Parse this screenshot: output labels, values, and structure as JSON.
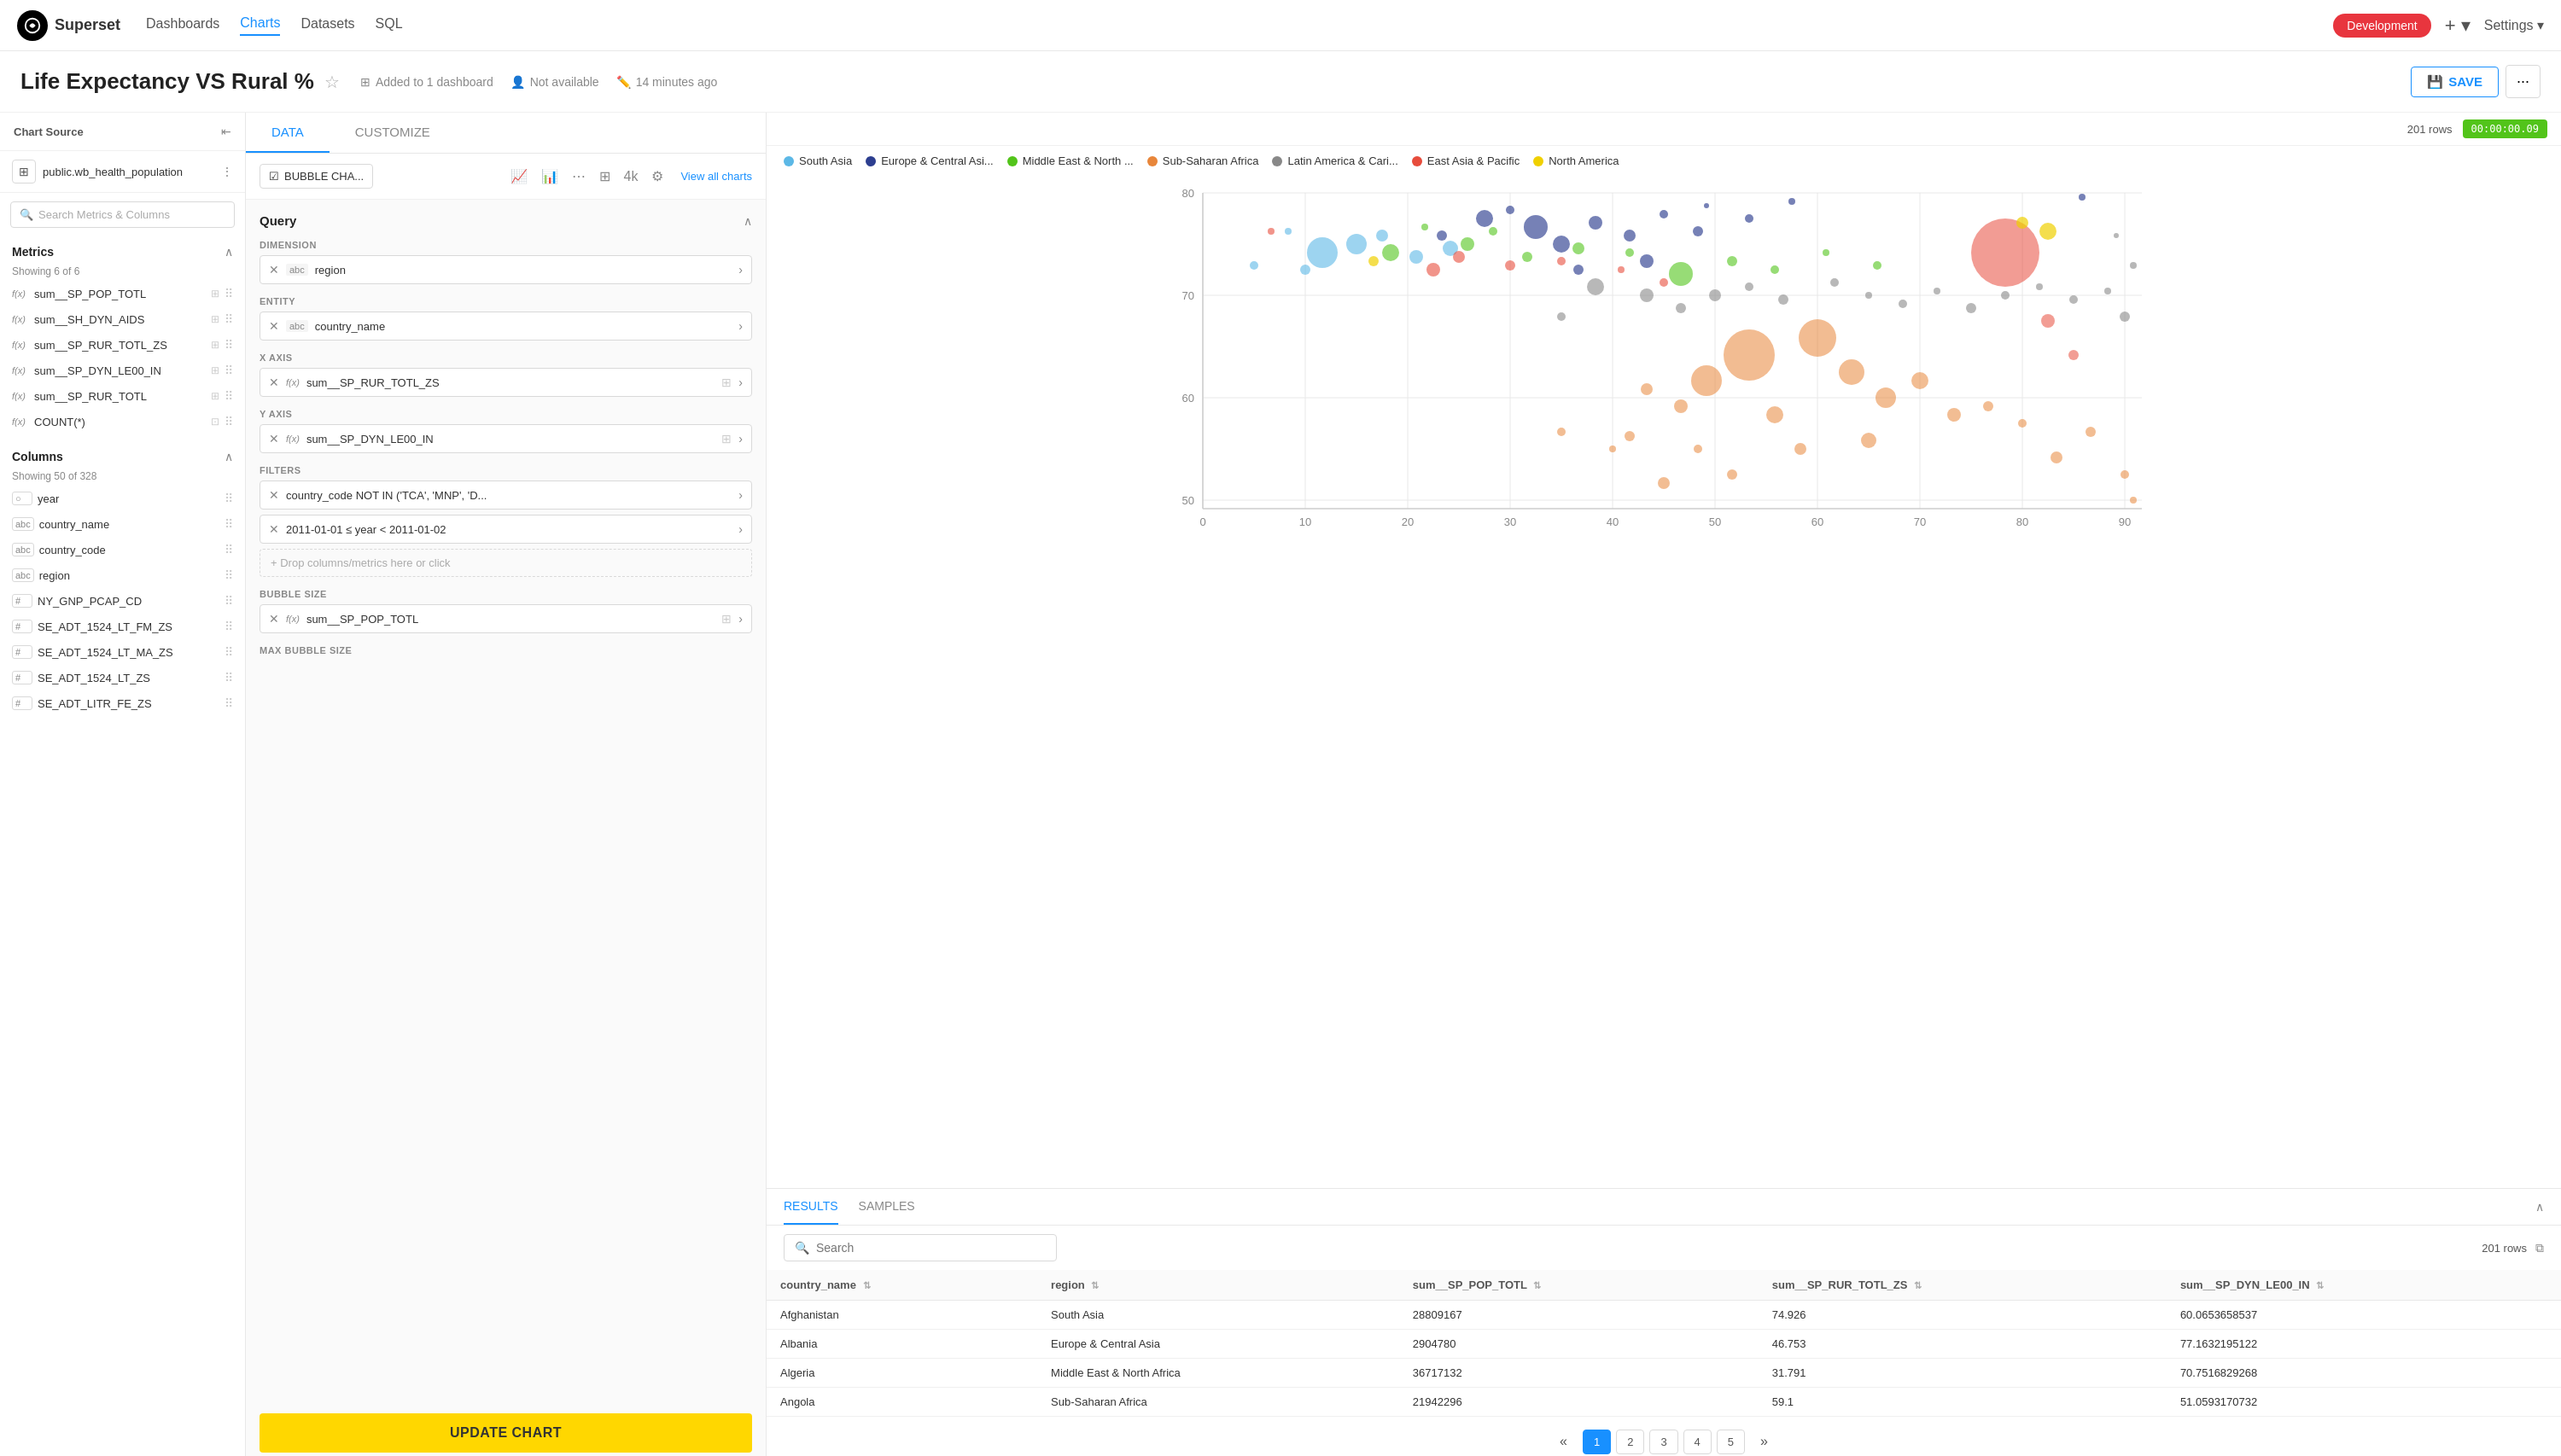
{
  "app": {
    "logo": "Superset",
    "environment": "Development"
  },
  "nav": {
    "links": [
      {
        "label": "Dashboards",
        "active": false
      },
      {
        "label": "Charts",
        "active": true
      },
      {
        "label": "Datasets",
        "active": false
      },
      {
        "label": "SQL",
        "active": false
      }
    ],
    "settings_label": "Settings ▾",
    "plus_label": "+ ▾"
  },
  "page": {
    "title": "Life Expectancy VS Rural %",
    "meta": [
      {
        "icon": "dashboard-icon",
        "text": "Added to 1 dashboard"
      },
      {
        "icon": "user-icon",
        "text": "Not available"
      },
      {
        "icon": "edit-icon",
        "text": "14 minutes ago"
      }
    ],
    "save_label": "SAVE"
  },
  "sidebar": {
    "chart_source_label": "Chart Source",
    "datasource": "public.wb_health_population",
    "search_placeholder": "Search Metrics & Columns",
    "metrics_label": "Metrics",
    "metrics_count": "Showing 6 of 6",
    "metrics": [
      {
        "name": "sum__SP_POP_TOTL",
        "type": "f(x)"
      },
      {
        "name": "sum__SH_DYN_AIDS",
        "type": "f(x)"
      },
      {
        "name": "sum__SP_RUR_TOTL_ZS",
        "type": "f(x)"
      },
      {
        "name": "sum__SP_DYN_LE00_IN",
        "type": "f(x)"
      },
      {
        "name": "sum__SP_RUR_TOTL",
        "type": "f(x)"
      },
      {
        "name": "COUNT(*)",
        "type": "f(x)"
      }
    ],
    "columns_label": "Columns",
    "columns_count": "Showing 50 of 328",
    "columns": [
      {
        "name": "year",
        "type": "○"
      },
      {
        "name": "country_name",
        "type": "abc"
      },
      {
        "name": "country_code",
        "type": "abc"
      },
      {
        "name": "region",
        "type": "abc"
      },
      {
        "name": "NY_GNP_PCAP_CD",
        "type": "#"
      },
      {
        "name": "SE_ADT_1524_LT_FM_ZS",
        "type": "#"
      },
      {
        "name": "SE_ADT_1524_LT_MA_ZS",
        "type": "#"
      },
      {
        "name": "SE_ADT_1524_LT_ZS",
        "type": "#"
      },
      {
        "name": "SE_ADT_LITR_FE_ZS",
        "type": "#"
      }
    ]
  },
  "center_panel": {
    "tabs": [
      "DATA",
      "CUSTOMIZE"
    ],
    "active_tab": "DATA",
    "chart_type": "BUBBLE CHA...",
    "toolbar_icons": [
      "line-chart",
      "bar-chart",
      "scatter-chart",
      "table",
      "4k",
      "settings"
    ],
    "view_all_label": "View all charts",
    "query_title": "Query",
    "dimension_label": "DIMENSION",
    "dimension_value": "region",
    "entity_label": "ENTITY",
    "entity_value": "country_name",
    "xaxis_label": "X AXIS",
    "xaxis_value": "sum__SP_RUR_TOTL_ZS",
    "yaxis_label": "Y AXIS",
    "yaxis_value": "sum__SP_DYN_LE00_IN",
    "filters_label": "FILTERS",
    "filter1": "country_code NOT IN ('TCA', 'MNP', 'D...",
    "filter2": "2011-01-01 ≤ year < 2011-01-02",
    "drop_zone": "+ Drop columns/metrics here or click",
    "bubble_size_label": "BUBBLE SIZE",
    "bubble_size_value": "sum__SP_POP_TOTL",
    "max_bubble_size_label": "MAX BUBBLE SIZE",
    "update_chart_label": "UPDATE CHART"
  },
  "chart": {
    "rows_count": "201 rows",
    "time_badge": "00:00:00.09",
    "legend": [
      {
        "label": "South Asia",
        "color": "#5cb8e6"
      },
      {
        "label": "Europe & Central Asi...",
        "color": "#2c3e8f"
      },
      {
        "label": "Middle East & North ...",
        "color": "#52c41a"
      },
      {
        "label": "Sub-Saharan Africa",
        "color": "#e8863a"
      },
      {
        "label": "Latin America & Cari...",
        "color": "#666"
      },
      {
        "label": "East Asia & Pacific",
        "color": "#e74c3c"
      },
      {
        "label": "North America",
        "color": "#f0d000"
      }
    ],
    "x_axis_ticks": [
      "0",
      "10",
      "20",
      "30",
      "40",
      "50",
      "60",
      "70",
      "80",
      "90"
    ],
    "y_axis_ticks": [
      "80",
      "70",
      "60",
      "50"
    ]
  },
  "results": {
    "tabs": [
      "RESULTS",
      "SAMPLES"
    ],
    "active_tab": "RESULTS",
    "search_placeholder": "Search",
    "rows_count": "201 rows",
    "columns": [
      {
        "label": "country_name",
        "sortable": true
      },
      {
        "label": "region",
        "sortable": true
      },
      {
        "label": "sum__SP_POP_TOTL",
        "sortable": true
      },
      {
        "label": "sum__SP_RUR_TOTL_ZS",
        "sortable": true
      },
      {
        "label": "sum__SP_DYN_LE00_IN",
        "sortable": true
      }
    ],
    "rows": [
      {
        "country_name": "Afghanistan",
        "region": "South Asia",
        "sum__SP_POP_TOTL": "28809167",
        "sum__SP_RUR_TOTL_ZS": "74.926",
        "sum__SP_DYN_LE00_IN": "60.0653658537"
      },
      {
        "country_name": "Albania",
        "region": "Europe & Central Asia",
        "sum__SP_POP_TOTL": "2904780",
        "sum__SP_RUR_TOTL_ZS": "46.753",
        "sum__SP_DYN_LE00_IN": "77.1632195122"
      },
      {
        "country_name": "Algeria",
        "region": "Middle East & North Africa",
        "sum__SP_POP_TOTL": "36717132",
        "sum__SP_RUR_TOTL_ZS": "31.791",
        "sum__SP_DYN_LE00_IN": "70.7516829268"
      },
      {
        "country_name": "Angola",
        "region": "Sub-Saharan Africa",
        "sum__SP_POP_TOTL": "21942296",
        "sum__SP_RUR_TOTL_ZS": "59.1",
        "sum__SP_DYN_LE00_IN": "51.0593170732"
      }
    ],
    "pagination": {
      "prev": "«",
      "pages": [
        "1",
        "2",
        "3",
        "4",
        "5"
      ],
      "next": "»",
      "active_page": "1"
    }
  }
}
